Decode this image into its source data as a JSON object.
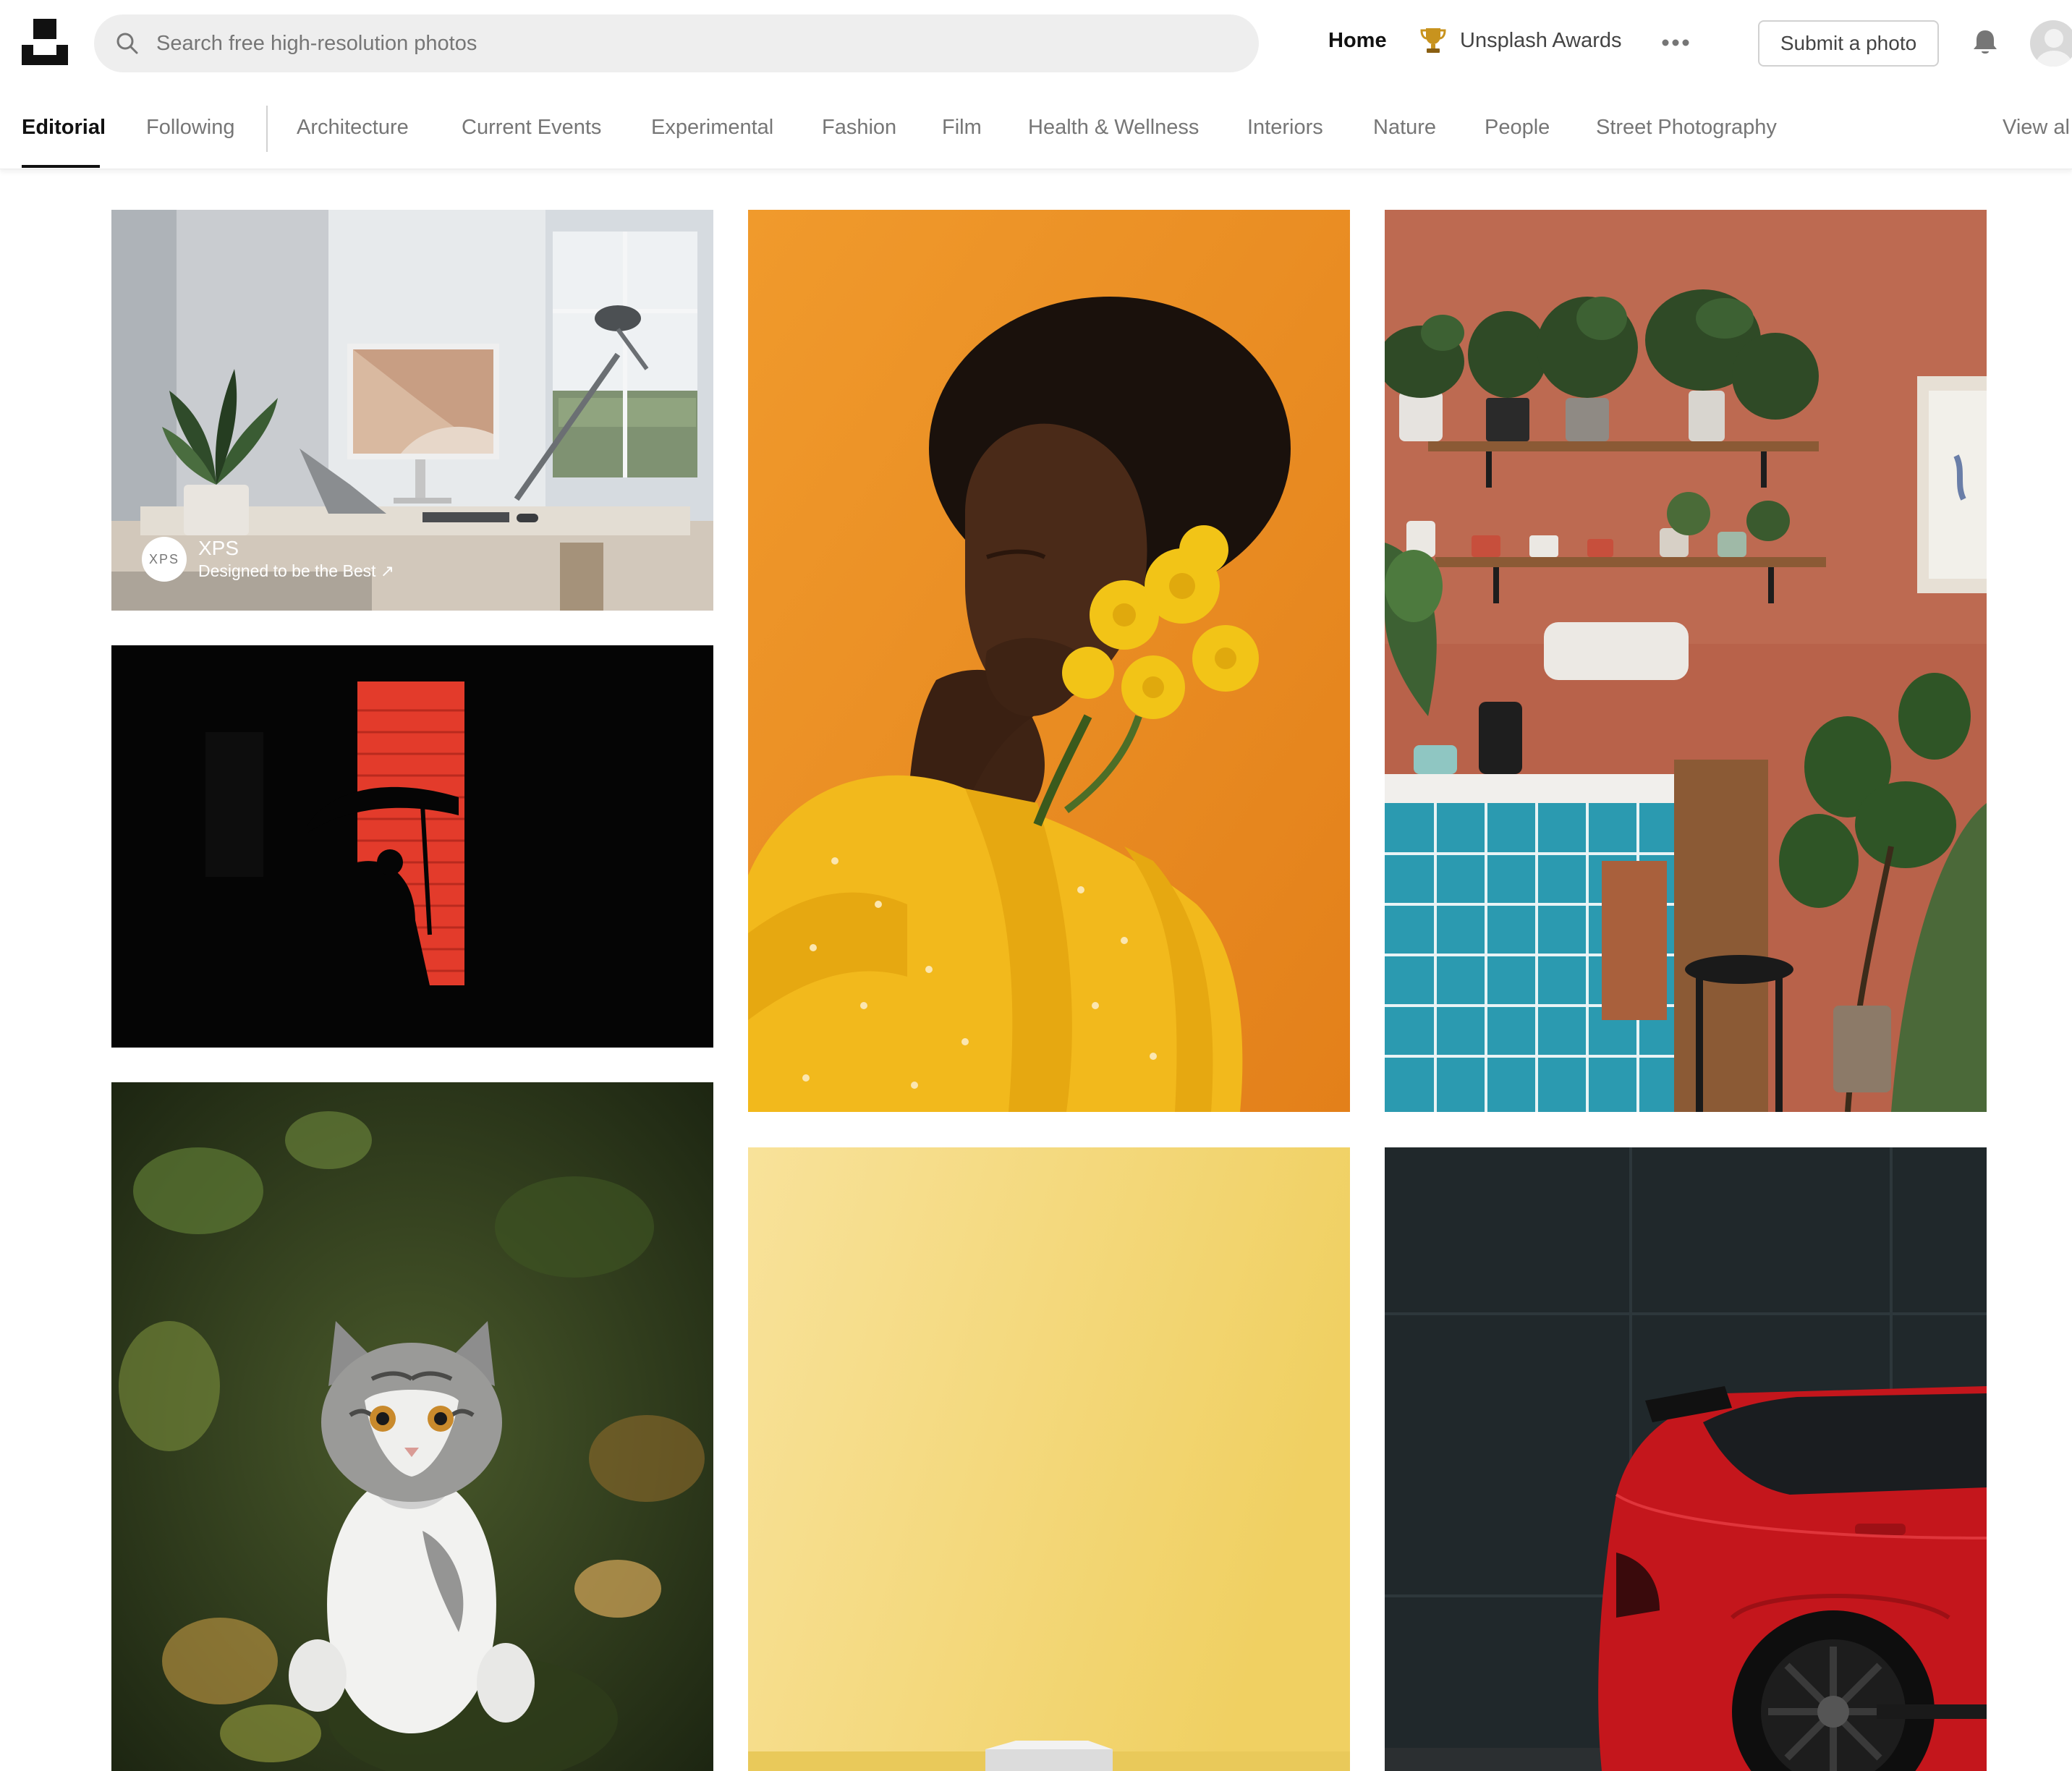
{
  "header": {
    "search_placeholder": "Search free high-resolution photos",
    "nav_home": "Home",
    "nav_awards": "Unsplash Awards",
    "submit_label": "Submit a photo"
  },
  "tabs": [
    {
      "label": "Editorial"
    },
    {
      "label": "Following"
    },
    {
      "label": "Architecture"
    },
    {
      "label": "Current Events"
    },
    {
      "label": "Experimental"
    },
    {
      "label": "Fashion"
    },
    {
      "label": "Film"
    },
    {
      "label": "Health & Wellness"
    },
    {
      "label": "Interiors"
    },
    {
      "label": "Nature"
    },
    {
      "label": "People"
    },
    {
      "label": "Street Photography"
    },
    {
      "label": "View al"
    }
  ],
  "sponsor": {
    "logo_text": "XPS",
    "name": "XPS",
    "tagline": "Designed to be the Best ↗"
  },
  "photos": [
    {
      "subject": "desk-workspace-photo"
    },
    {
      "subject": "red-window-silhouette-photo"
    },
    {
      "subject": "kitten-photo"
    },
    {
      "subject": "woman-yellow-flowers-photo"
    },
    {
      "subject": "yellow-backdrop-photo"
    },
    {
      "subject": "plant-shelves-kitchen-photo"
    },
    {
      "subject": "red-car-photo"
    }
  ],
  "colors": {
    "accent": "#111111",
    "muted_text": "#767676",
    "search_bg": "#eeeeee",
    "trophy": "#c8931e"
  }
}
